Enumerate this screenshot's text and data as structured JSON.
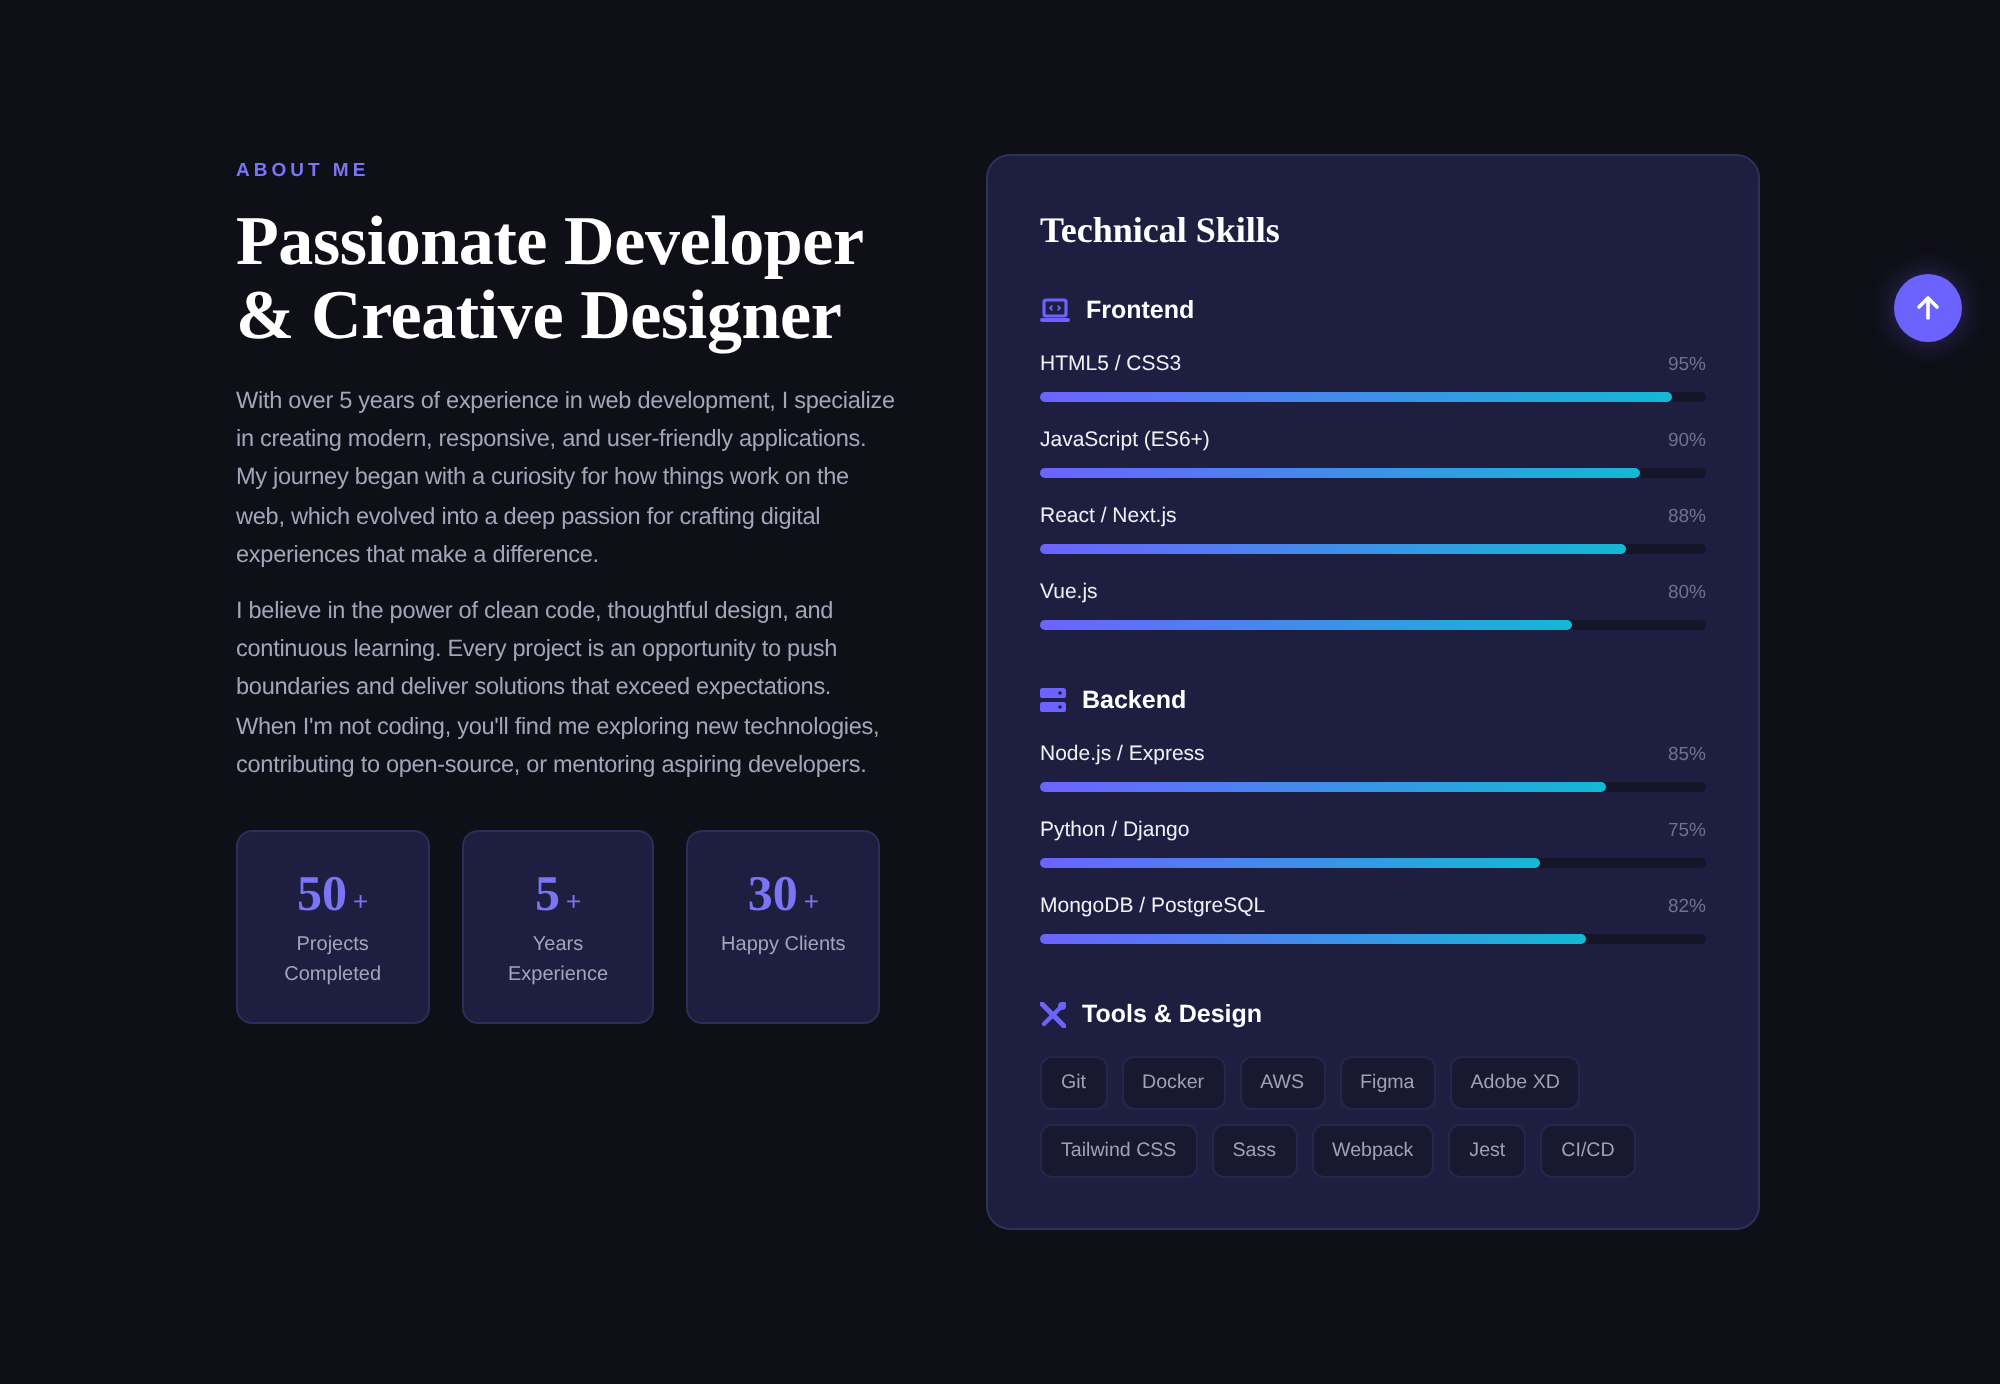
{
  "about": {
    "eyebrow": "ABOUT ME",
    "title_lines": [
      "Passionate Developer",
      "& Creative Designer"
    ],
    "paragraphs": [
      "With over 5 years of experience in web development, I specialize in creating modern, responsive, and user-friendly applications. My journey began with a curiosity for how things work on the web, which evolved into a deep passion for crafting digital experiences that make a difference.",
      "I believe in the power of clean code, thoughtful design, and continuous learning. Every project is an opportunity to push boundaries and deliver solutions that exceed expectations. When I'm not coding, you'll find me exploring new technologies, contributing to open-source, or mentoring aspiring developers."
    ],
    "stats": [
      {
        "number": "50",
        "suffix": "+",
        "label": "Projects Completed"
      },
      {
        "number": "5",
        "suffix": "+",
        "label": "Years Experience"
      },
      {
        "number": "30",
        "suffix": "+",
        "label": "Happy Clients"
      }
    ]
  },
  "skills_card": {
    "title": "Technical Skills",
    "groups": [
      {
        "kind": "laptop",
        "title": "Frontend",
        "skills": [
          {
            "name": "HTML5 / CSS3",
            "reading": "95%",
            "level": 0.95
          },
          {
            "name": "JavaScript (ES6+)",
            "reading": "90%",
            "level": 0.9
          },
          {
            "name": "React / Next.js",
            "reading": "88%",
            "level": 0.88
          },
          {
            "name": "Vue.js",
            "reading": "80%",
            "level": 0.8
          }
        ]
      },
      {
        "kind": "server",
        "title": "Backend",
        "skills": [
          {
            "name": "Node.js / Express",
            "reading": "85%",
            "level": 0.85
          },
          {
            "name": "Python / Django",
            "reading": "75%",
            "level": 0.75
          },
          {
            "name": "MongoDB / PostgreSQL",
            "reading": "82%",
            "level": 0.82
          }
        ]
      },
      {
        "kind": "tools",
        "title": "Tools & Design",
        "tags": [
          "Git",
          "Docker",
          "AWS",
          "Figma",
          "Adobe XD",
          "Tailwind CSS",
          "Sass",
          "Webpack",
          "Jest",
          "CI/CD"
        ]
      }
    ]
  },
  "back_to_top": {
    "kind": "arrow-up"
  }
}
